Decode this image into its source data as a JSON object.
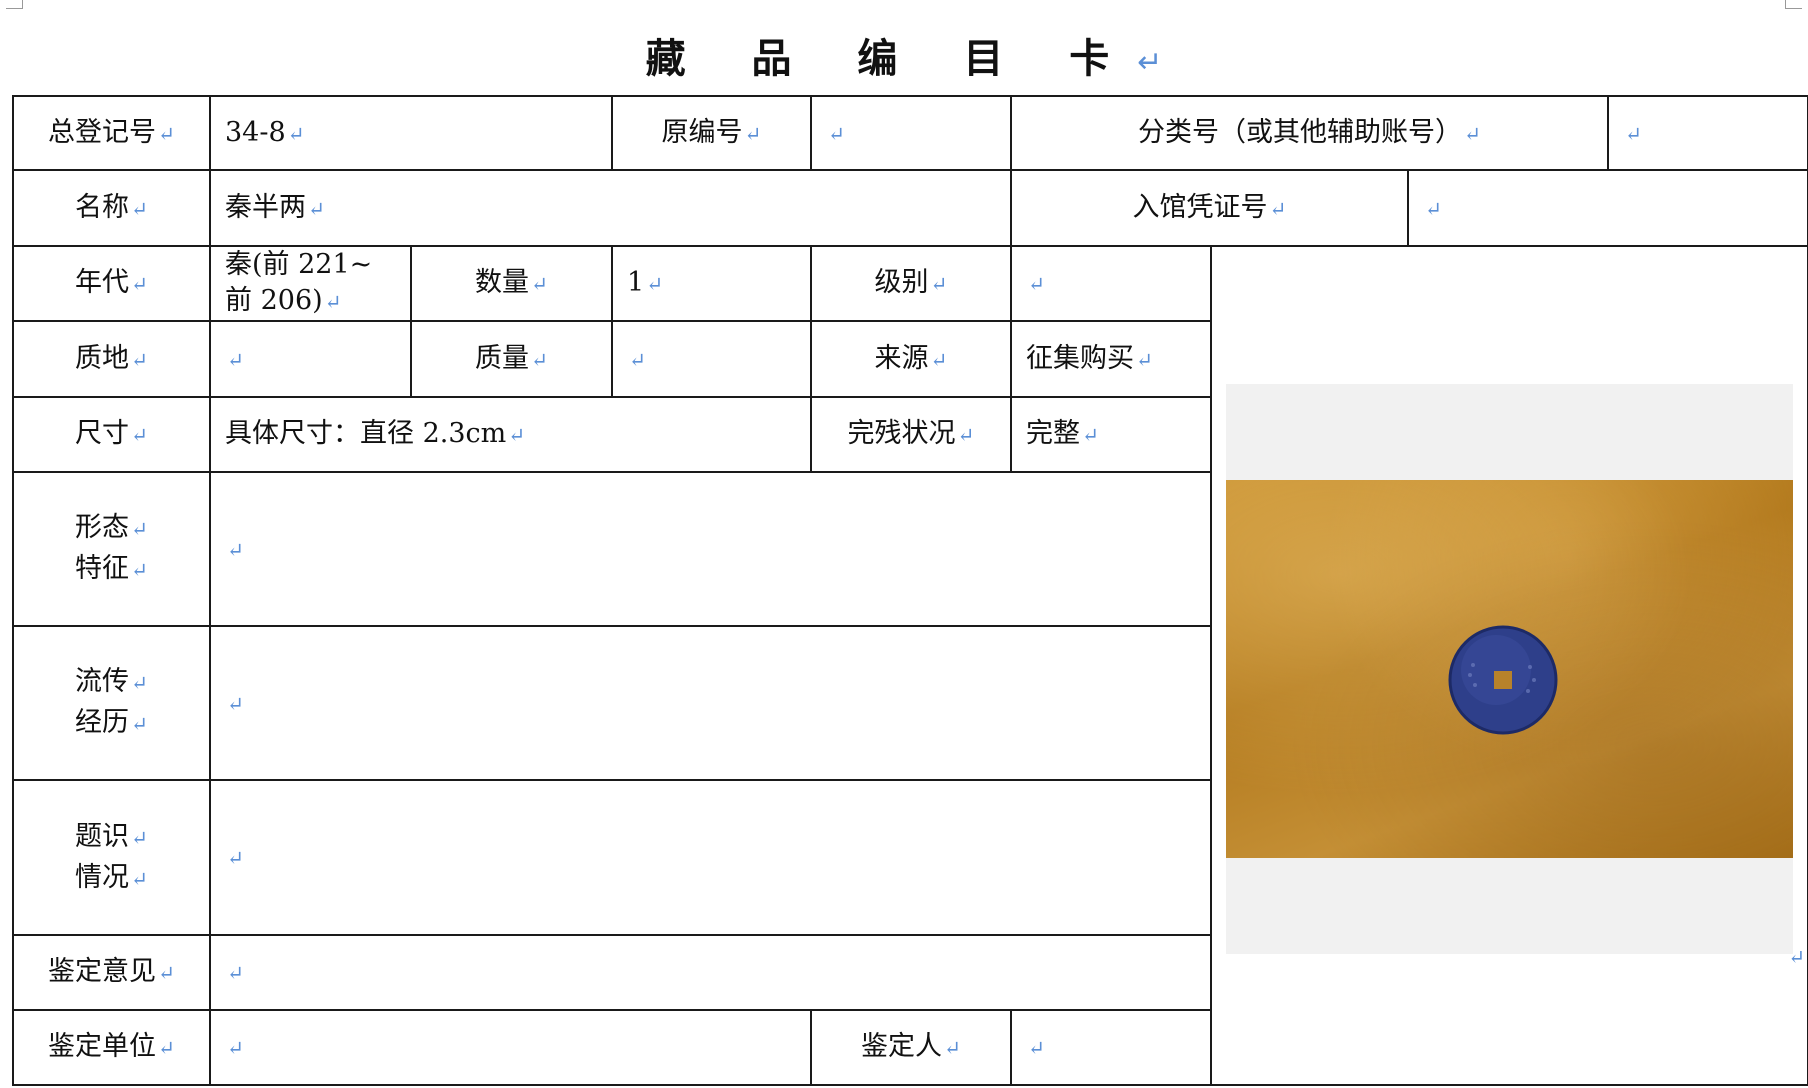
{
  "title": "藏 品 编 目 卡",
  "para_mark": "↵",
  "row1": {
    "reg_no_label": "总登记号",
    "reg_no": "34-8",
    "orig_no_label": "原编号",
    "orig_no": "",
    "class_no_label": "分类号（或其他辅助账号）",
    "class_no": ""
  },
  "row2": {
    "name_label": "名称",
    "name": "秦半两",
    "voucher_label": "入馆凭证号",
    "voucher": ""
  },
  "row3": {
    "era_label": "年代",
    "era": "秦(前 221~前 206)",
    "qty_label": "数量",
    "qty": "1",
    "grade_label": "级别",
    "grade": ""
  },
  "row4": {
    "material_label": "质地",
    "material": "",
    "weight_label": "质量",
    "weight": "",
    "source_label": "来源",
    "source": "征集购买"
  },
  "row5": {
    "size_label": "尺寸",
    "size": "具体尺寸：直径 2.3cm",
    "condition_label": "完残状况",
    "condition": "完整"
  },
  "form_features": {
    "label_1": "形态",
    "label_2": "特征",
    "value": ""
  },
  "provenance": {
    "label_1": "流传",
    "label_2": "经历",
    "value": ""
  },
  "inscription": {
    "label_1": "题识",
    "label_2": "情况",
    "value": ""
  },
  "appraisal_opinion": {
    "label": "鉴定意见",
    "value": ""
  },
  "appraisal_unit": {
    "label": "鉴定单位",
    "value": "",
    "appraiser_label": "鉴定人",
    "appraiser": ""
  },
  "photo": {
    "background_color": "#b8822a",
    "coin_color": "#2e3f8a"
  }
}
